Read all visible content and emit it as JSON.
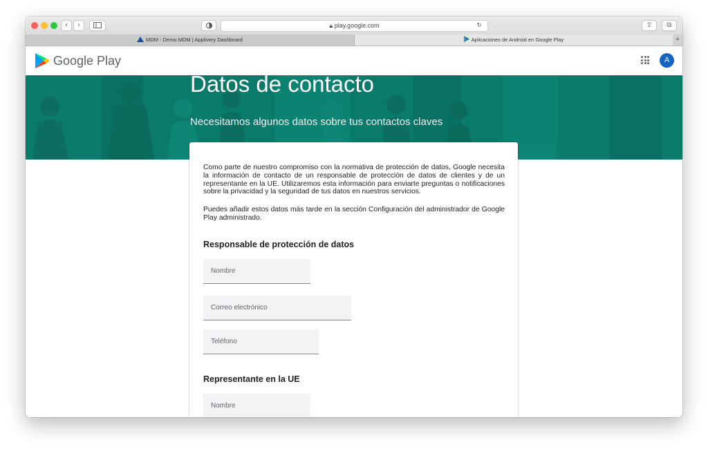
{
  "browser": {
    "url": "play.google.com",
    "tabs": [
      {
        "label": "MDM - Demo MDM | Applivery Dashboard"
      },
      {
        "label": "Aplicaciones de Android en Google Play"
      }
    ],
    "new_tab": "+"
  },
  "header": {
    "logo_text": "Google Play",
    "avatar_letter": "A"
  },
  "banner": {
    "title": "Datos de contacto",
    "subtitle": "Necesitamos algunos datos sobre tus contactos claves"
  },
  "form": {
    "intro": "Como parte de nuestro compromiso con la normativa de protección de datos, Google necesita la información de contacto de un responsable de protección de datos de clientes y de un representante en la UE. Utilizaremos esta información para enviarte preguntas o notificaciones sobre la privacidad y la seguridad de tus datos en nuestros servicios.",
    "note": "Puedes añadir estos datos más tarde en la sección Configuración del administrador de Google Play administrado.",
    "dpo_section": {
      "title": "Responsable de protección de datos",
      "name_placeholder": "Nombre",
      "email_placeholder": "Correo electrónico",
      "phone_placeholder": "Teléfono"
    },
    "eu_section": {
      "title": "Representante en la UE",
      "name_placeholder": "Nombre"
    }
  },
  "colors": {
    "banner": "#0a7a6b",
    "avatar": "#1565c0"
  }
}
